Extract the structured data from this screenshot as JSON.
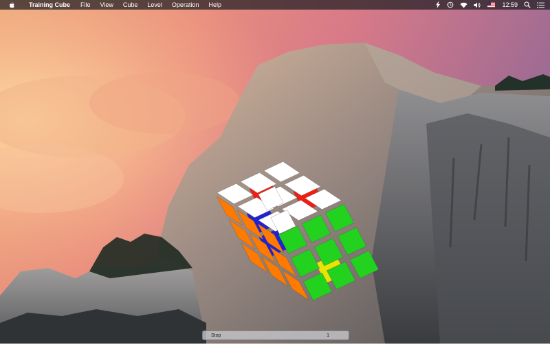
{
  "menubar": {
    "app_name": "Training Cube",
    "menus": [
      "File",
      "View",
      "Cube",
      "Level",
      "Operation",
      "Help"
    ],
    "clock": "12:59",
    "status_icons": [
      "bolt-icon",
      "time-machine-icon",
      "wifi-icon",
      "volume-icon",
      "flag-icon",
      "search-icon",
      "list-icon"
    ]
  },
  "statusbar": {
    "stop_label": "Stop",
    "move_count": "1"
  },
  "cube": {
    "colors": {
      "white": "#ffffff",
      "orange": "#ff7a00",
      "green": "#22d21f",
      "blue": "#1a1ed6",
      "yellow": "#f2e800",
      "red": "#f21a10"
    }
  }
}
